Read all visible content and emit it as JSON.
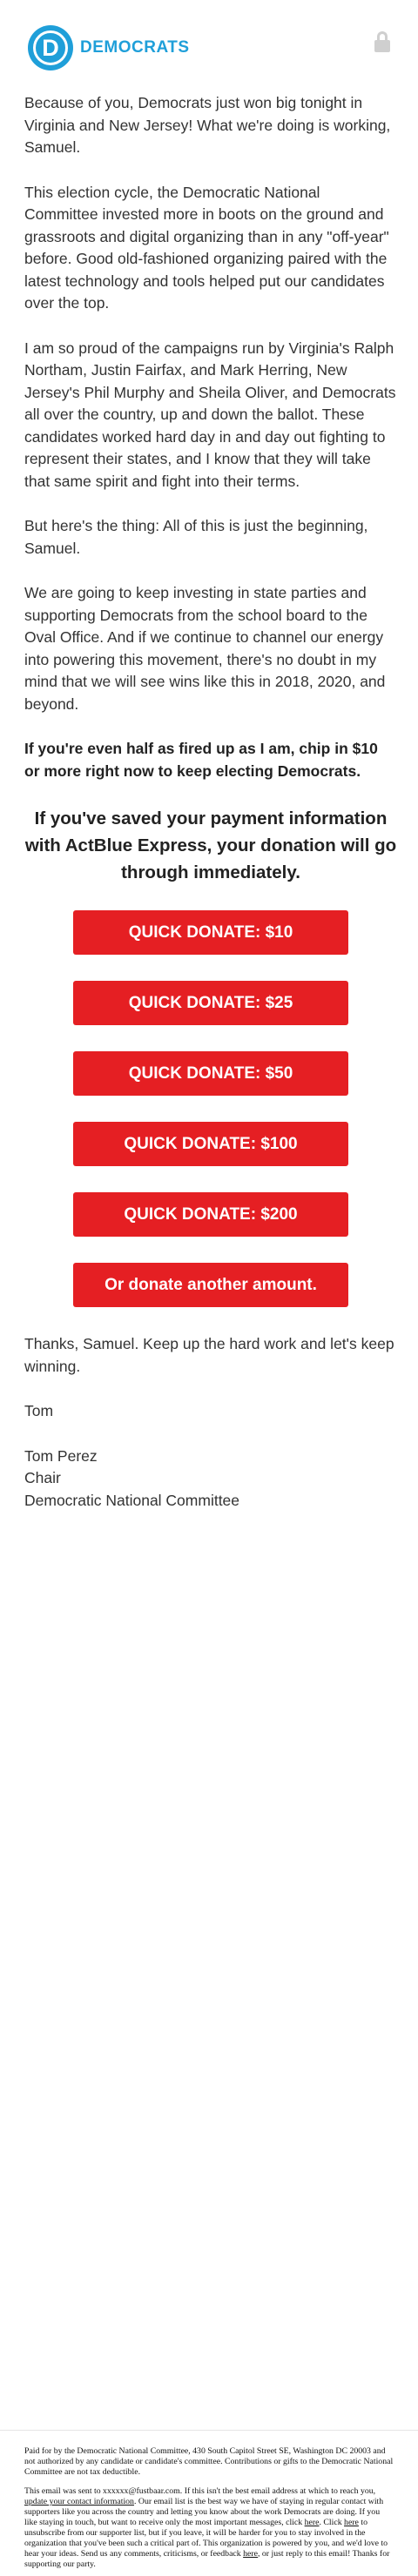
{
  "header": {
    "logo_letter": "D",
    "logo_text": "DEMOCRATS",
    "logo_color": "#1f9fd9",
    "lock_icon": "lock-icon"
  },
  "body": {
    "paragraphs": [
      "Because of you, Democrats just won big tonight in Virginia and New Jersey! What we're doing is working, Samuel.",
      "This election cycle, the Democratic National Committee invested more in boots on the ground and grassroots and digital organizing than in any \"off-year\" before. Good old-fashioned organizing paired with the latest technology and tools helped put our candidates over the top.",
      "I am so proud of the campaigns run by Virginia's Ralph Northam, Justin Fairfax, and Mark Herring, New Jersey's Phil Murphy and Sheila Oliver, and Democrats all over the country, up and down the ballot. These candidates worked hard day in and day out fighting to represent their states, and I know that they will take that same spirit and fight into their terms.",
      "But here's the thing: All of this is just the beginning, Samuel.",
      "We are going to keep investing in state parties and supporting Democrats from the school board to the Oval Office. And if we continue to channel our energy into powering this movement, there's no doubt in my mind that we will see wins like this in 2018, 2020, and beyond."
    ],
    "bold_ask": "If you're even half as fired up as I am, chip in $10 or more right now to keep electing Democrats.",
    "callout": "If you've saved your payment information with ActBlue Express, your donation will go through immediately.",
    "buttons": [
      "QUICK DONATE: $10",
      "QUICK DONATE: $25",
      "QUICK DONATE: $50",
      "QUICK DONATE: $100",
      "QUICK DONATE: $200",
      "Or donate another amount."
    ],
    "button_color": "#e51f23",
    "closing": "Thanks, Samuel. Keep up the hard work and let's keep winning.",
    "sign_first": "Tom",
    "sign_name": "Tom Perez",
    "sign_title": "Chair",
    "sign_org": "Democratic National Committee"
  },
  "footer": {
    "paid_for": "Paid for by the Democratic National Committee, 430 South Capitol Street SE, Washington DC 20003 and not authorized by any candidate or candidate's committee. Contributions or gifts to the Democratic National Committee are not tax deductible.",
    "sent_to_1": "This email was sent to xxxxxx@fustbaar.com. If this isn't the best email address at which to reach you,",
    "update_link": "update your contact information",
    "sent_to_2": ". Our email list is the best way we have of staying in regular contact with supporters like you across the country and letting you know about the work Democrats are doing. If you like staying in touch, but want to receive only the most important messages, click",
    "here_link_1": "here",
    "sent_to_3": ". Click",
    "here_link_2": "here",
    "sent_to_4": "to unsubscribe from our supporter list, but if you leave, it will be harder for you to stay involved in the organization that you've been such a critical part of. This organization is powered by you, and we'd love to hear your ideas. Send us any comments, criticisms, or feedback",
    "here_link_3": "here",
    "sent_to_5": ", or just reply to this email! Thanks for supporting our party."
  }
}
